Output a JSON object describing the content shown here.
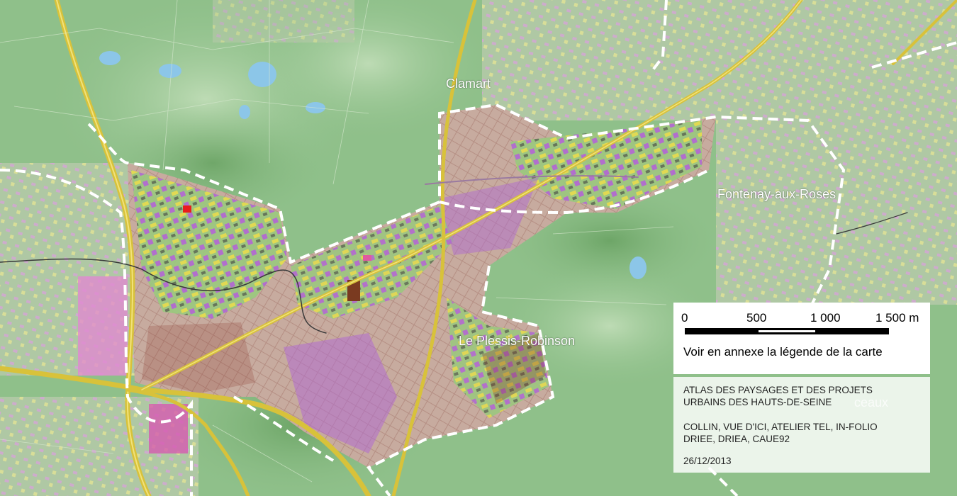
{
  "places": {
    "clamart": "Clamart",
    "fontenay": "Fontenay-aux-Roses",
    "plessis": "Le Plessis-Robinson",
    "sceaux_partial": "ceaux"
  },
  "scale": {
    "ticks": [
      "0",
      "500",
      "1 000",
      "1 500 m"
    ],
    "note": "Voir en annexe la légende de la carte"
  },
  "credits": {
    "title_line1": "ATLAS DES PAYSAGES ET DES PROJETS",
    "title_line2": "URBAINS DES HAUTS-DE-SEINE",
    "authors_line1": "COLLIN, VUE D'ICI, ATELIER TEL, IN-FOLIO",
    "authors_line2": "DRIEE, DRIEA, CAUE92",
    "date": "26/12/2013"
  },
  "colors": {
    "terrain": "#8fc08a",
    "urban": "#c9b3a8",
    "building_purple": "#a35cc8",
    "building_yellow": "#e6e04a",
    "road_major": "#d8c23a",
    "boundary": "#ffffff",
    "water": "#8cc6e8"
  }
}
